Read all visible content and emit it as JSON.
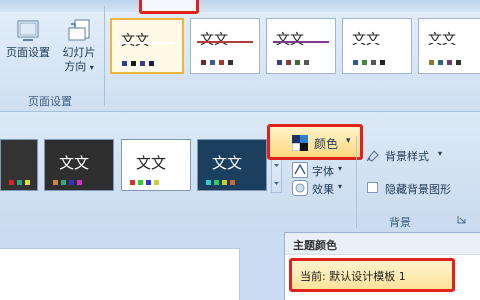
{
  "page_setup_group": {
    "label": "页面设置",
    "page_setup_button": {
      "label": "页面设置"
    },
    "slide_orientation_button": {
      "label_line1": "幻灯片",
      "label_line2": "方向",
      "dropdown": "▾"
    }
  },
  "themes_gallery": {
    "thumbnails": [
      {
        "text": "文文",
        "line_color": "#ffffff",
        "colors": [
          "#2b3f8c",
          "#1a1a1a",
          "#3b3b8f",
          "#1d1d4d"
        ],
        "selected": true
      },
      {
        "text": "文文",
        "line_color": "#b63b3b",
        "colors": [
          "#6a2b2b",
          "#3b5b9b",
          "#a33",
          "#333"
        ]
      },
      {
        "text": "文文",
        "line_color": "#7a3b8b",
        "colors": [
          "#3b3b8b",
          "#8b3b3b",
          "#3b6b3b",
          "#555"
        ]
      },
      {
        "text": "文文",
        "line_color": "#ffffff",
        "colors": [
          "#2b5b9b",
          "#3b8b3b",
          "#555",
          "#222"
        ]
      },
      {
        "text": "文文",
        "line_color": "#ffffff",
        "colors": [
          "#8b7b2b",
          "#2b6b6b",
          "#6b3b6b",
          "#333"
        ]
      }
    ]
  },
  "background_gallery": {
    "thumbnails": [
      {
        "text": "",
        "bg": "#333333",
        "text_color": "#ffffff",
        "colors": [
          "#d22",
          "#2a8",
          "#dd3"
        ]
      },
      {
        "text": "文文",
        "bg": "#2f2f2f",
        "text_color": "#ffffff",
        "colors": [
          "#c83",
          "#3a7",
          "#33c",
          "#c3c"
        ]
      },
      {
        "text": "文文",
        "bg": "#ffffff",
        "text_color": "#222222",
        "colors": [
          "#c33",
          "#3c3",
          "#33c",
          "#cc3"
        ]
      },
      {
        "text": "文文",
        "bg": "#1b3f5f",
        "text_color": "#ffffff",
        "colors": [
          "#3cc",
          "#3c6",
          "#cc3",
          "#c63"
        ]
      }
    ]
  },
  "theme_tools": {
    "colors_label": "颜色",
    "colors_dropdown": "▾",
    "fonts_label": "字体",
    "fonts_dropdown": "▾",
    "effects_label": "效果",
    "effects_dropdown": "▾"
  },
  "background_group": {
    "label": "背景",
    "background_styles_label": "背景样式",
    "background_styles_dropdown": "▾",
    "hide_background_graphics_label": "隐藏背景图形"
  },
  "colors_dropdown_panel": {
    "header": "主题颜色",
    "current_label": "当前: 默认设计模板 1"
  }
}
